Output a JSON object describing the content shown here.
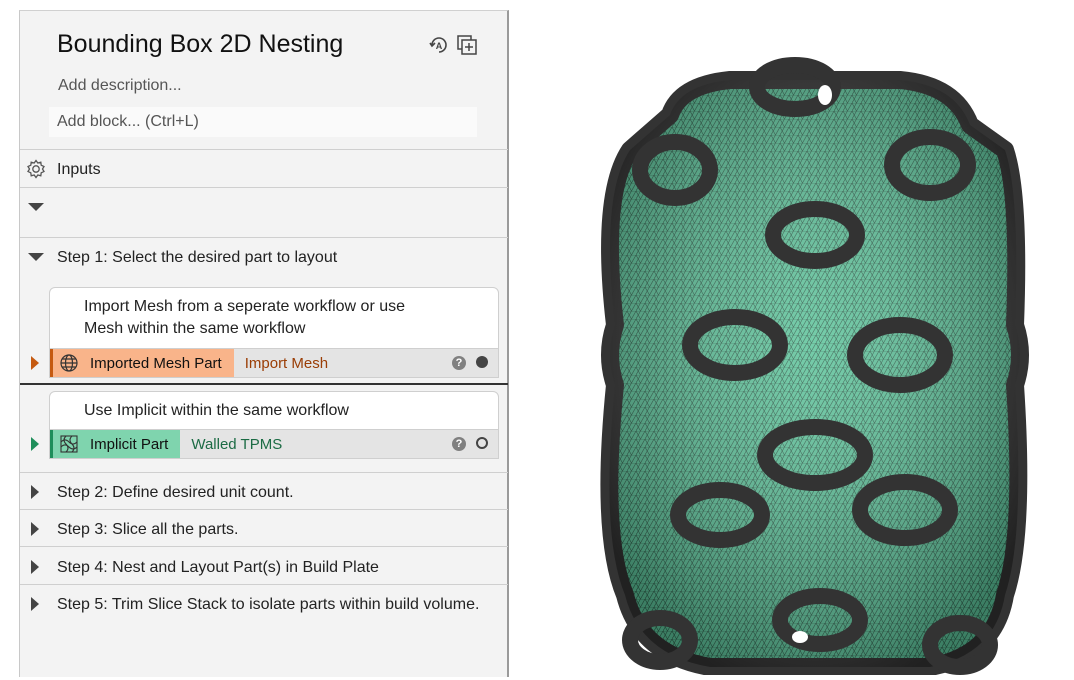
{
  "panel": {
    "title": "Bounding Box 2D Nesting",
    "description_placeholder": "Add description...",
    "add_block_placeholder": "Add block... (Ctrl+L)",
    "header_icons": [
      "auto-run-icon",
      "duplicate-icon"
    ],
    "inputs_label": "Inputs",
    "step1": {
      "label": "Step 1: Select the desired part to layout",
      "blocks": [
        {
          "card_text_line1": "Import Mesh from a seperate workflow or use",
          "card_text_line2": "Mesh within the same workflow",
          "tag": "Imported Mesh Part",
          "name": "Import Mesh",
          "icon": "globe-mesh-icon",
          "tag_color": "#f9b48a",
          "accent_color": "#c55a11",
          "name_color": "#9a3d05",
          "help": "?",
          "status": "filled"
        },
        {
          "card_text_line1": "Use Implicit within the same workflow",
          "tag": "Implicit Part",
          "name": "Walled TPMS",
          "icon": "implicit-lattice-icon",
          "tag_color": "#7fd4ae",
          "accent_color": "#1e8e5a",
          "name_color": "#1b6b44",
          "help": "?",
          "status": "hollow"
        }
      ]
    },
    "steps": [
      "Step 2: Define desired unit count.",
      "Step 3: Slice all the parts.",
      "Step 4: Nest and Layout Part(s) in Build Plate",
      "Step 5: Trim Slice Stack to isolate parts within build volume."
    ]
  },
  "viewport": {
    "mesh_color": "#5cc39a",
    "edge_color": "#333333"
  }
}
